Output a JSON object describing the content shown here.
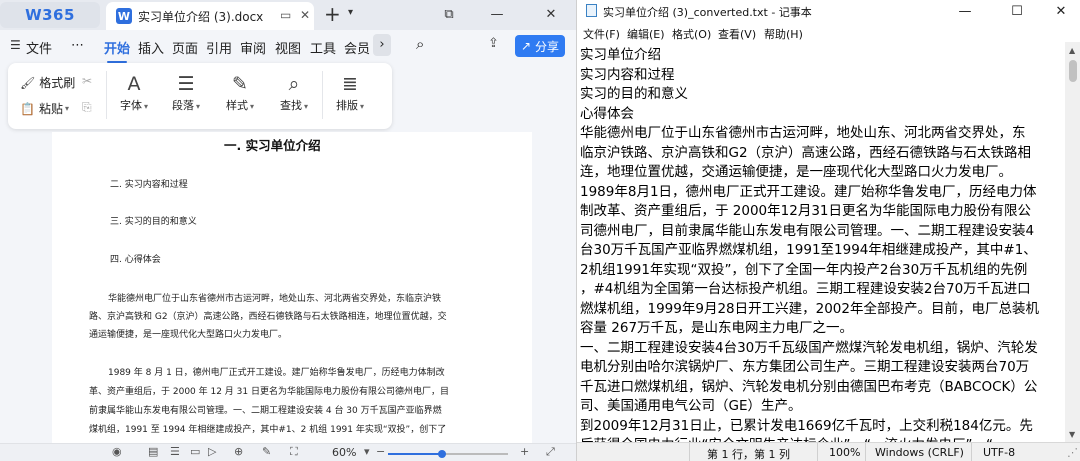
{
  "wps": {
    "logo": "W365",
    "tab_icon": "W",
    "tab_title": "实习单位介绍 (3).docx",
    "menu": [
      "文件",
      "⋯",
      "开始",
      "插入",
      "页面",
      "引用",
      "审阅",
      "视图",
      "工具",
      "会员"
    ],
    "share": "分享",
    "ribbon": {
      "format_painter": "格式刷",
      "paste": "粘贴",
      "font": "字体",
      "paragraph": "段落",
      "style": "样式",
      "find": "查找",
      "layout": "排版"
    },
    "doc": {
      "heading": "一.  实习单位介绍",
      "outline": [
        "二.    实习内容和过程",
        "三.    实习的目的和意义",
        "四.    心得体会"
      ],
      "para1": [
        "华能德州电厂位于山东省德州市古运河畔，地处山东、河北两省交界处，东临京沪铁",
        "路、京沪高铁和 G2（京沪）高速公路，西经石德铁路与石太铁路相连，地理位置优越，交",
        "通运输便捷，是一座现代化大型路口火力发电厂。"
      ],
      "para2": [
        "1989 年 8 月 1 日，德州电厂正式开工建设。建厂始称华鲁发电厂，历经电力体制改",
        "革、资产重组后，于 2000 年 12 月 31 日更名为华能国际电力股份有限公司德州电厂，目",
        "前隶属华能山东发电有限公司管理。一、二期工程建设安装 4 台 30 万千瓦国产亚临界燃",
        "煤机组，1991 至 1994 年相继建成投产，其中#1、2 机组 1991 年实现“双投”，创下了"
      ]
    },
    "status": {
      "zoom": "60%",
      "zoom_fraction": 0.45
    }
  },
  "notepad": {
    "title": "实习单位介绍 (3)_converted.txt - 记事本",
    "menu": [
      "文件(F)",
      "编辑(E)",
      "格式(O)",
      "查看(V)",
      "帮助(H)"
    ],
    "lines": [
      "实习单位介绍",
      "实习内容和过程",
      "实习的目的和意义",
      "心得体会",
      "华能德州电厂位于山东省德州市古运河畔，地处山东、河北两省交界处，东",
      "临京沪铁路、京沪高铁和G2（京沪）高速公路，西经石德铁路与石太铁路相",
      "连，地理位置优越，交通运输便捷，是一座现代化大型路口火力发电厂。",
      "1989年8月1日，德州电厂正式开工建设。建厂始称华鲁发电厂，历经电力体",
      "制改革、资产重组后，于 2000年12月31日更名为华能国际电力股份有限公",
      "司德州电厂，目前隶属华能山东发电有限公司管理。一、二期工程建设安装4",
      "台30万千瓦国产亚临界燃煤机组，1991至1994年相继建成投产，其中#1、",
      "2机组1991年实现“双投”，创下了全国一年内投产2台30万千瓦机组的先例",
      "，#4机组为全国第一台达标投产机组。三期工程建设安装2台70万千瓦进口",
      "燃煤机组，1999年9月28日开工兴建，2002年全部投产。目前，电厂总装机",
      "容量 267万千瓦，是山东电网主力电厂之一。",
      "一、二期工程建设安装4台30万千瓦级国产燃煤汽轮发电机组，锅炉、汽轮发",
      "电机分别由哈尔滨锅炉厂、东方集团公司生产。三期工程建设安装两台70万",
      "千瓦进口燃煤机组，锅炉、汽轮发电机分别由德国巴布考克（BABCOCK）公",
      "司、美国通用电气公司（GE）生产。",
      "到2009年12月31日止，已累计发电1669亿千瓦时，上交利税184亿元。先",
      "后获得全国电力行业“安全文明生产达标企业”、“一流火力发电厂”、“"
    ],
    "status": {
      "position": "第 1 行，第 1 列",
      "zoom": "100%",
      "eol": "Windows (CRLF)",
      "encoding": "UTF-8"
    }
  }
}
